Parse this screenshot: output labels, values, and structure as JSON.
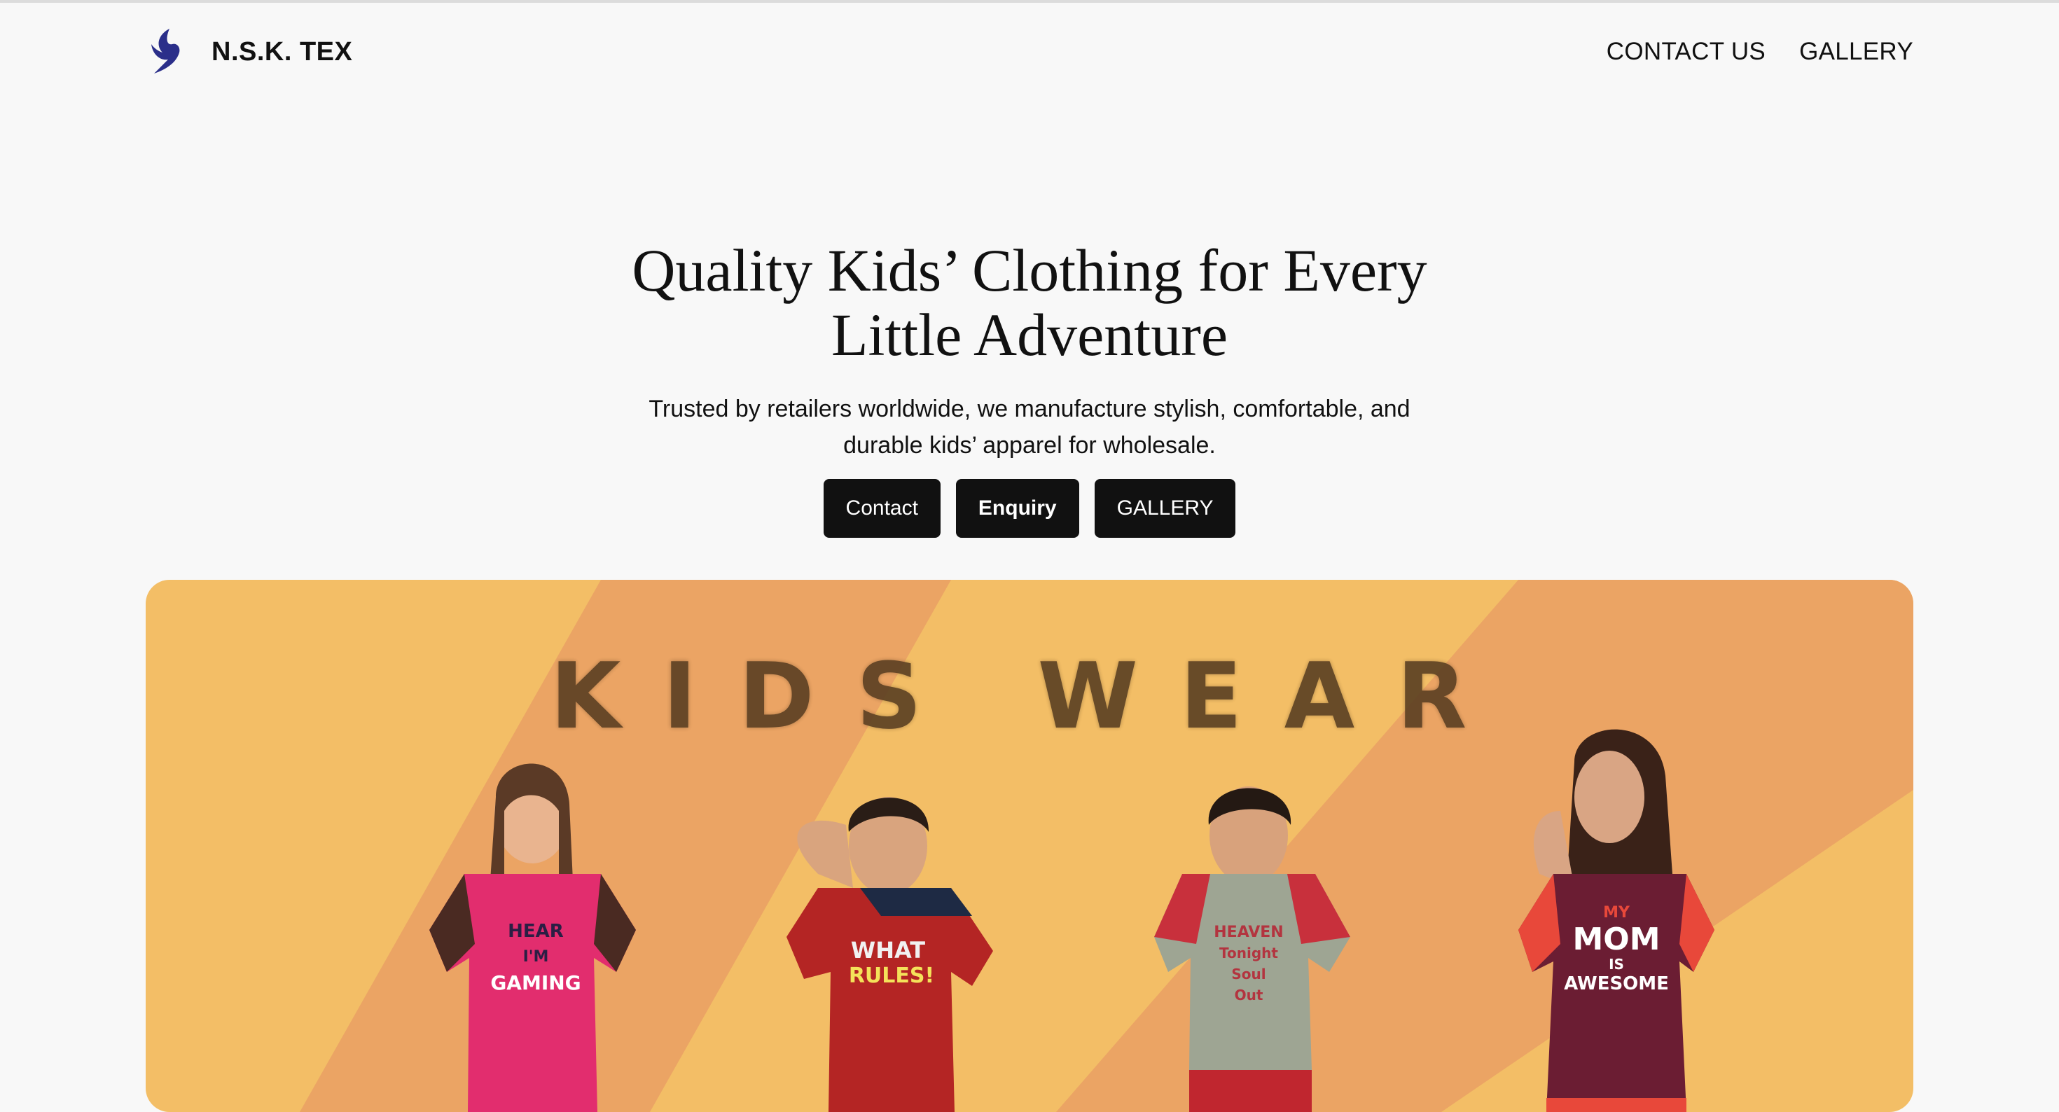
{
  "brand": {
    "name": "N.S.K. TEX",
    "logo_icon": "bird-wing-logo-icon"
  },
  "nav": {
    "contact": "CONTACT US",
    "gallery": "GALLERY"
  },
  "hero": {
    "title": "Quality Kids’ Clothing for Every Little Adventure",
    "subtitle": "Trusted by retailers worldwide, we manufacture stylish, comfortable, and durable kids’ apparel for wholesale.",
    "buttons": {
      "contact": "Contact",
      "enquiry": "Enquiry",
      "gallery": "GALLERY"
    }
  },
  "banner": {
    "title": "KIDS WEAR",
    "shirt_texts": {
      "girl1": [
        "HEAR",
        "I'M",
        "GAMING"
      ],
      "boy1": [
        "WHAT",
        "RULES!"
      ],
      "boy2": [
        "HEAVEN",
        "Tonight",
        "Soul",
        "Out"
      ],
      "girl2": [
        "MY",
        "MOM",
        "IS",
        "AWESOME"
      ]
    },
    "colors": {
      "background": "#f3be66",
      "stripe": "#eba464"
    }
  },
  "colors": {
    "page_bg": "#f8f8f8",
    "button_bg": "#111111",
    "logo": "#2b2f8a"
  }
}
